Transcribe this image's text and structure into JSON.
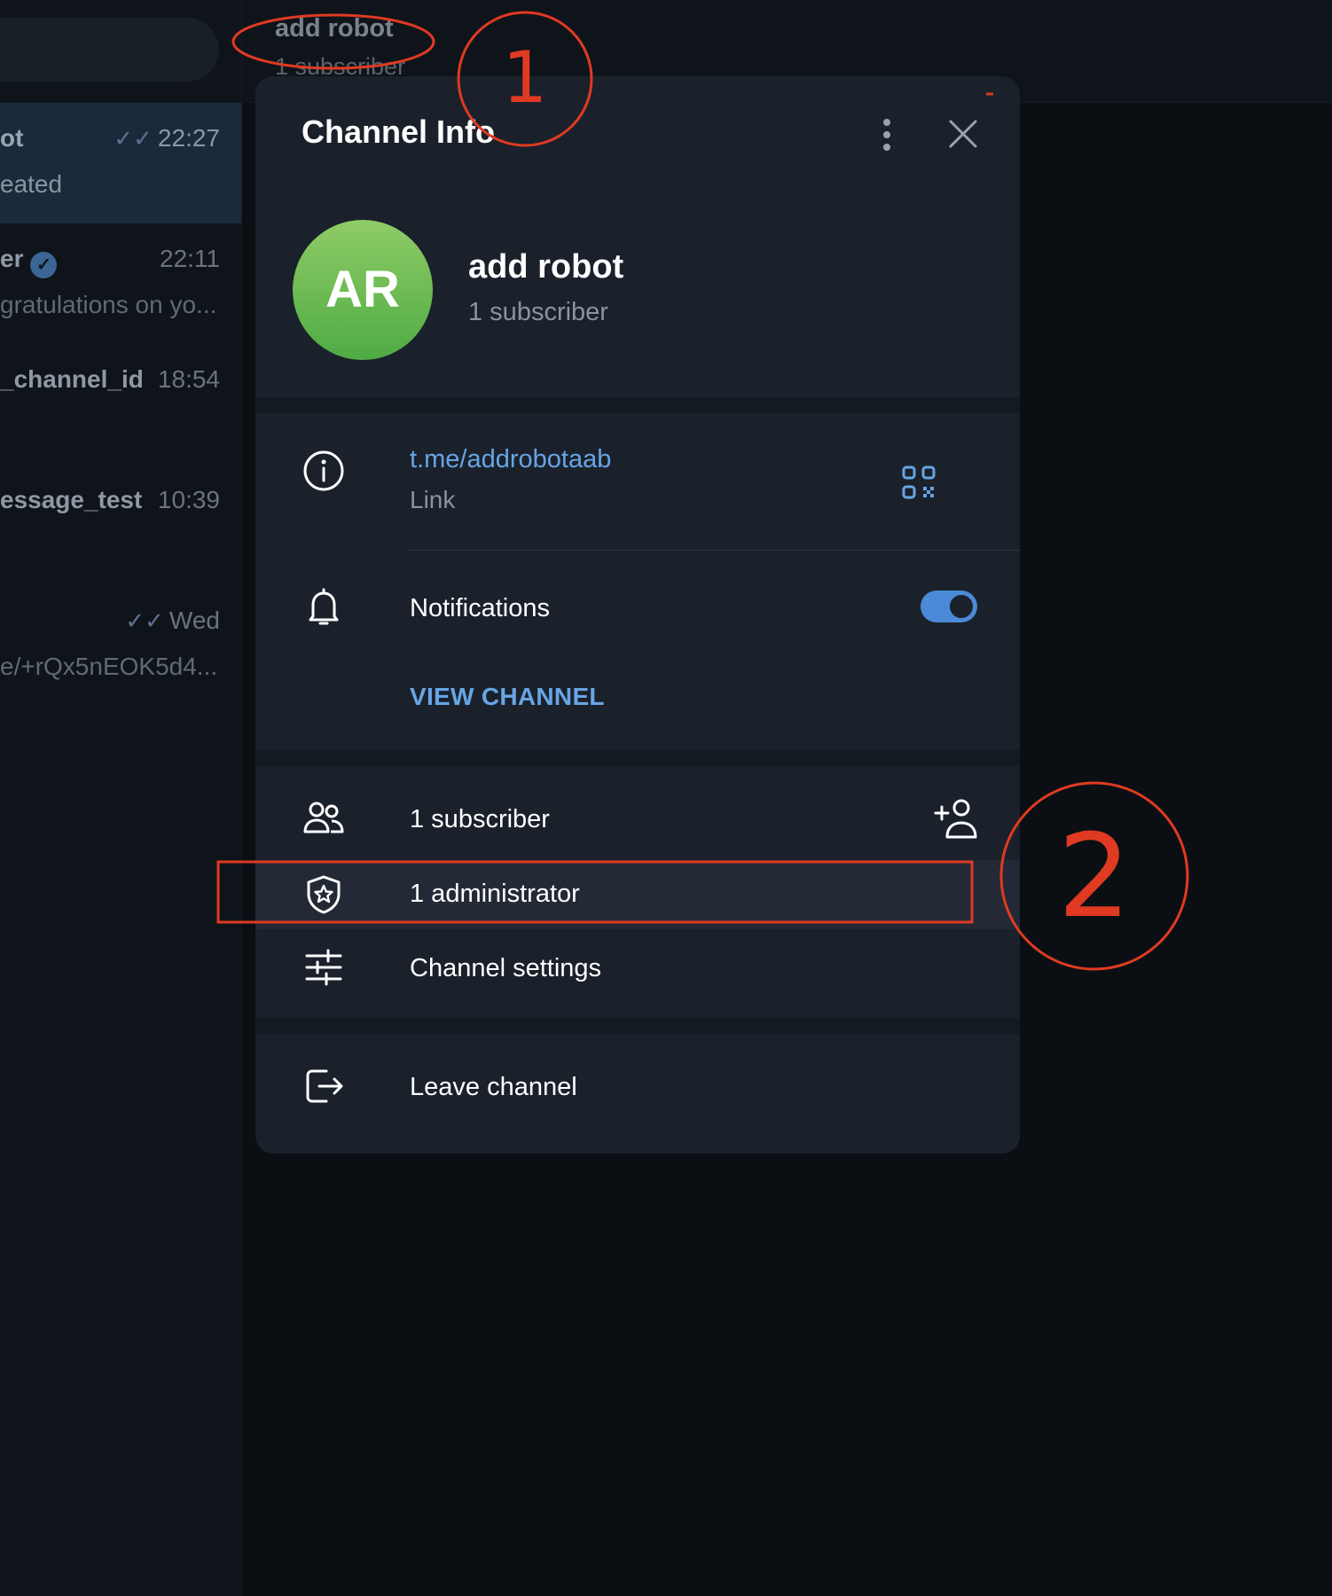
{
  "chat_list": {
    "items": [
      {
        "name": "ot",
        "preview": "eated",
        "time": "22:27",
        "read_ticks": true,
        "verified": false,
        "active": true
      },
      {
        "name": "er",
        "preview": "gratulations on yo...",
        "time": "22:11",
        "read_ticks": false,
        "verified": true,
        "active": false
      },
      {
        "name": "_channel_id",
        "preview": "",
        "time": "18:54",
        "read_ticks": false,
        "verified": false,
        "active": false
      },
      {
        "name": "essage_test",
        "preview": "",
        "time": "10:39",
        "read_ticks": false,
        "verified": false,
        "active": false
      },
      {
        "name": "",
        "preview": "e/+rQx5nEOK5d4...",
        "time": "Wed",
        "read_ticks": true,
        "verified": false,
        "active": false
      }
    ]
  },
  "header": {
    "title": "add robot",
    "subtitle": "1 subscriber"
  },
  "modal": {
    "title": "Channel Info",
    "avatar_initials": "AR",
    "avatar_color": "#5fb64d",
    "channel_name": "add robot",
    "channel_subtitle": "1 subscriber",
    "link": {
      "url": "t.me/addrobotaab",
      "caption": "Link"
    },
    "notifications": {
      "label": "Notifications",
      "enabled": true
    },
    "view_channel_label": "VIEW CHANNEL",
    "members": {
      "subscribers_label": "1 subscriber",
      "administrators_label": "1 administrator",
      "settings_label": "Channel settings"
    },
    "leave_label": "Leave channel"
  },
  "annotations": {
    "marker_1": "1",
    "marker_2": "2",
    "color": "#e03a22"
  },
  "colors": {
    "accent": "#67a5e6",
    "panel": "#1b212b",
    "background": "#0b0f14"
  }
}
